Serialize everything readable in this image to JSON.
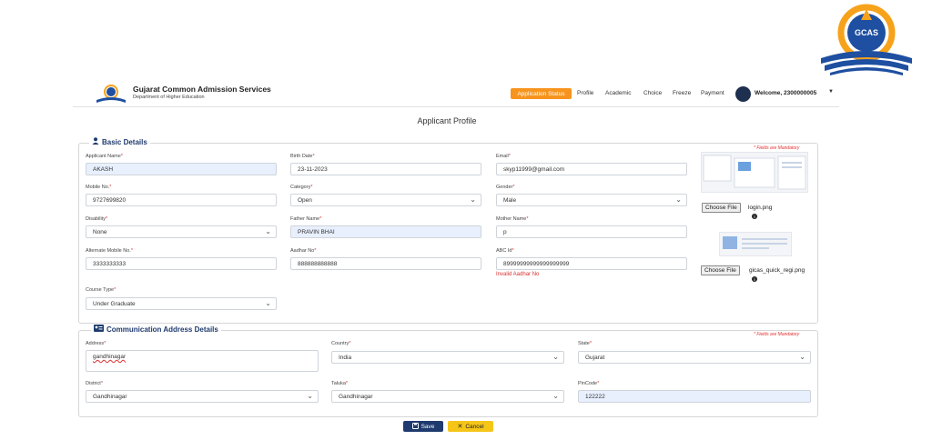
{
  "header": {
    "brand_title": "Gujarat Common Admission Services",
    "brand_subtitle": "Department of Higher Education",
    "logo_text": "GCAS",
    "nav": {
      "application_status": "Application Status",
      "profile": "Profile",
      "academic": "Academic",
      "choice": "Choice",
      "freeze": "Freeze",
      "payment": "Payment"
    },
    "welcome": "Welcome, 2300000005"
  },
  "page_title": "Applicant Profile",
  "basic": {
    "legend": "Basic Details",
    "mandatory_note": "* Fields are Mandatory",
    "applicant_name": {
      "label": "Applicant Name",
      "value": "AKASH"
    },
    "birth_date": {
      "label": "Birth Date",
      "value": "23-11-2023"
    },
    "email": {
      "label": "Email",
      "value": "skyp11999@gmail.com"
    },
    "mobile": {
      "label": "Mobile No.",
      "value": "9727699820"
    },
    "category": {
      "label": "Category",
      "value": "Open"
    },
    "gender": {
      "label": "Gender",
      "value": "Male"
    },
    "disability": {
      "label": "Disability",
      "value": "None"
    },
    "father_name": {
      "label": "Father Name",
      "value": "PRAVIN BHAI"
    },
    "mother_name": {
      "label": "Mother Name",
      "value": "p"
    },
    "alt_mobile": {
      "label": "Alternate Mobile No.",
      "value": "3333333333"
    },
    "aadhar": {
      "label": "Aadhar No",
      "value": "888888888888"
    },
    "abc_id": {
      "label": "ABC Id",
      "value": "89999999999999999999",
      "error": "Invalid Aadhar No"
    },
    "course_type": {
      "label": "Course Type",
      "value": "Under Graduate"
    },
    "upload1": {
      "button": "Choose File",
      "filename": "login.png"
    },
    "upload2": {
      "button": "Choose File",
      "filename": "gicas_quick_regi.png"
    }
  },
  "address": {
    "legend": "Communication Address Details",
    "mandatory_note": "* Fields are Mandatory",
    "address": {
      "label": "Address",
      "value": "gandhinagar"
    },
    "country": {
      "label": "Country",
      "value": "India"
    },
    "state": {
      "label": "State",
      "value": "Gujarat"
    },
    "district": {
      "label": "District",
      "value": "Gandhinagar"
    },
    "taluka": {
      "label": "Taluka",
      "value": "Gandhinagar"
    },
    "pincode": {
      "label": "PinCode",
      "value": "122222"
    }
  },
  "actions": {
    "save": "Save",
    "cancel": "Cancel"
  },
  "icons": {
    "user": "user-icon",
    "address_card": "address-card-icon",
    "save": "save-icon",
    "cancel": "close-icon",
    "info": "info-icon"
  }
}
